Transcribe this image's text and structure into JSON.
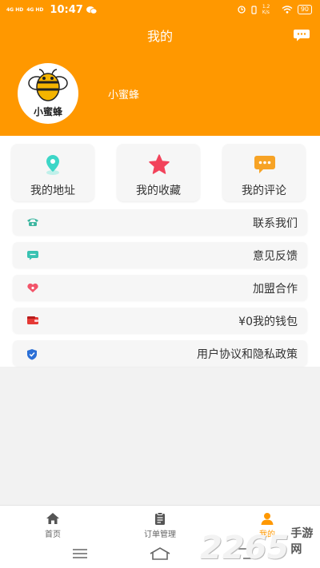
{
  "status_bar": {
    "net1": "4G HD",
    "net2": "4G HD",
    "time": "10:47",
    "speed": "1.2 K/s",
    "battery": "90"
  },
  "header": {
    "title": "我的",
    "avatar_text": "小蜜蜂",
    "username": "小蜜蜂",
    "bg_color": "#ff9800"
  },
  "quick_actions": [
    {
      "label": "我的地址",
      "icon": "location-pin-icon",
      "color": "#3dd6c7"
    },
    {
      "label": "我的收藏",
      "icon": "star-icon",
      "color": "#f2435b"
    },
    {
      "label": "我的评论",
      "icon": "comment-icon",
      "color": "#f7a325"
    }
  ],
  "menu": [
    {
      "label": "联系我们",
      "icon": "phone-icon",
      "color": "#3cb6a0"
    },
    {
      "label": "意见反馈",
      "icon": "feedback-icon",
      "color": "#39c2b2"
    },
    {
      "label": "加盟合作",
      "icon": "handshake-icon",
      "color": "#f2556a"
    },
    {
      "label": "¥0我的钱包",
      "icon": "wallet-icon",
      "color": "#e53935"
    },
    {
      "label": "用户协议和隐私政策",
      "icon": "shield-icon",
      "color": "#2b6fd6"
    }
  ],
  "tabs": [
    {
      "label": "首页",
      "icon": "home-icon"
    },
    {
      "label": "订单管理",
      "icon": "clipboard-icon"
    },
    {
      "label": "我的",
      "icon": "user-icon",
      "active": true
    }
  ],
  "watermark": {
    "number": "2265",
    "text": "手游网"
  }
}
